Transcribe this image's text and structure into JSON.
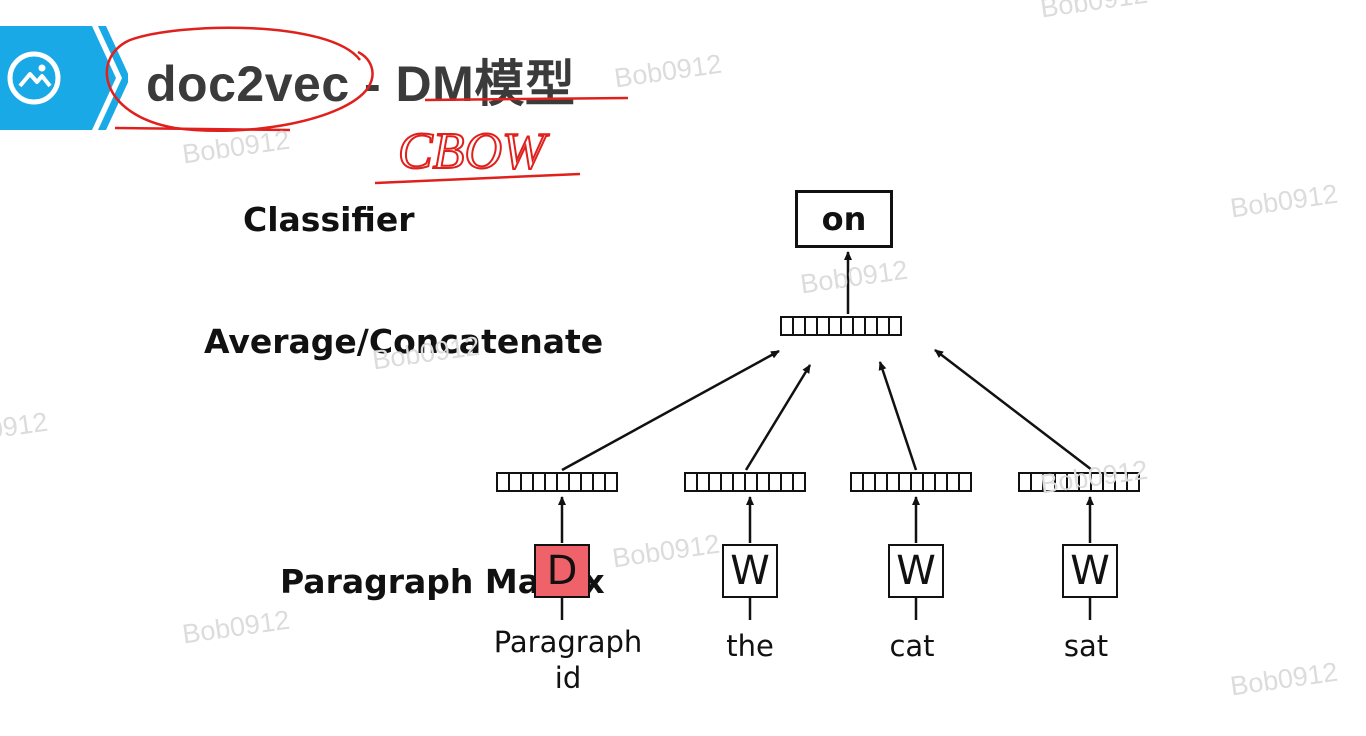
{
  "header": {
    "title": "doc2vec - DM模型",
    "annotation": "CBOW",
    "badge_icon": "image-icon",
    "accent_color": "#19a9e6",
    "annotation_color": "#e0201c"
  },
  "labels": {
    "classifier": "Classifier",
    "average": "Average/Concatenate",
    "paragraph_matrix": "Paragraph Matrix"
  },
  "diagram": {
    "output": "on",
    "inputs": [
      {
        "token": "D",
        "word": "Paragraph id",
        "highlight": "#f0626a"
      },
      {
        "token": "W",
        "word": "the"
      },
      {
        "token": "W",
        "word": "cat"
      },
      {
        "token": "W",
        "word": "sat"
      }
    ]
  },
  "watermark": "Bob0912"
}
